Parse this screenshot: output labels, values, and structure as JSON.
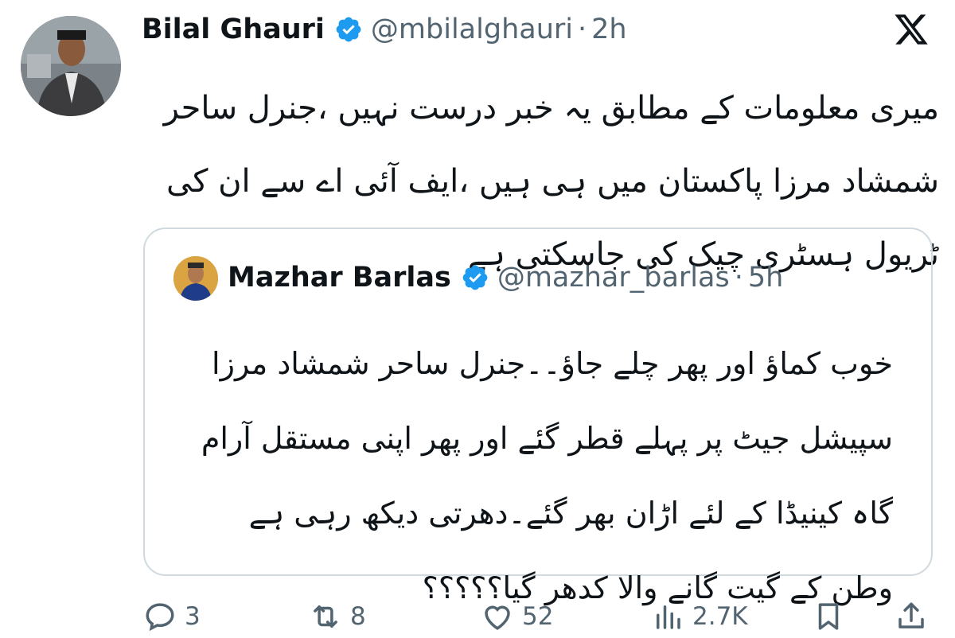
{
  "tweet": {
    "author_name": "Bilal Ghauri",
    "handle": "@mbilalghauri",
    "separator": "·",
    "time": "2h",
    "text": "میری معلومات کے مطابق یہ خبر درست نہیں ،جنرل ساحر شمشاد مرزا پاکستان میں ہی ہیں ،ایف آئی اے سے ان کی ٹریول ہسٹری چیک کی جاسکتی ہے"
  },
  "quote": {
    "author_name": "Mazhar Barlas",
    "handle": "@mazhar_barlas",
    "separator": "·",
    "time": "5h",
    "text": "خوب کماؤ اور پھر چلے جاؤ۔۔جنرل ساحر شمشاد مرزا سپیشل جیٹ پر پہلے قطر گئے اور پھر اپنی مستقل آرام گاہ کینیڈا کے لئے اڑان بھر گئے۔دھرتی دیکھ رہی ہے وطن کے گیت گانے والا کدھر گیا؟؟؟؟؟"
  },
  "actions": {
    "replies": "3",
    "reposts": "8",
    "likes": "52",
    "views": "2.7K"
  },
  "colors": {
    "verified": "#1d9bf0",
    "text": "#0f1419",
    "secondary": "#536471",
    "border": "#cfd9de"
  },
  "icons": [
    "verified-icon",
    "x-logo-icon",
    "reply-icon",
    "repost-icon",
    "like-icon",
    "views-icon",
    "bookmark-icon",
    "share-icon"
  ]
}
